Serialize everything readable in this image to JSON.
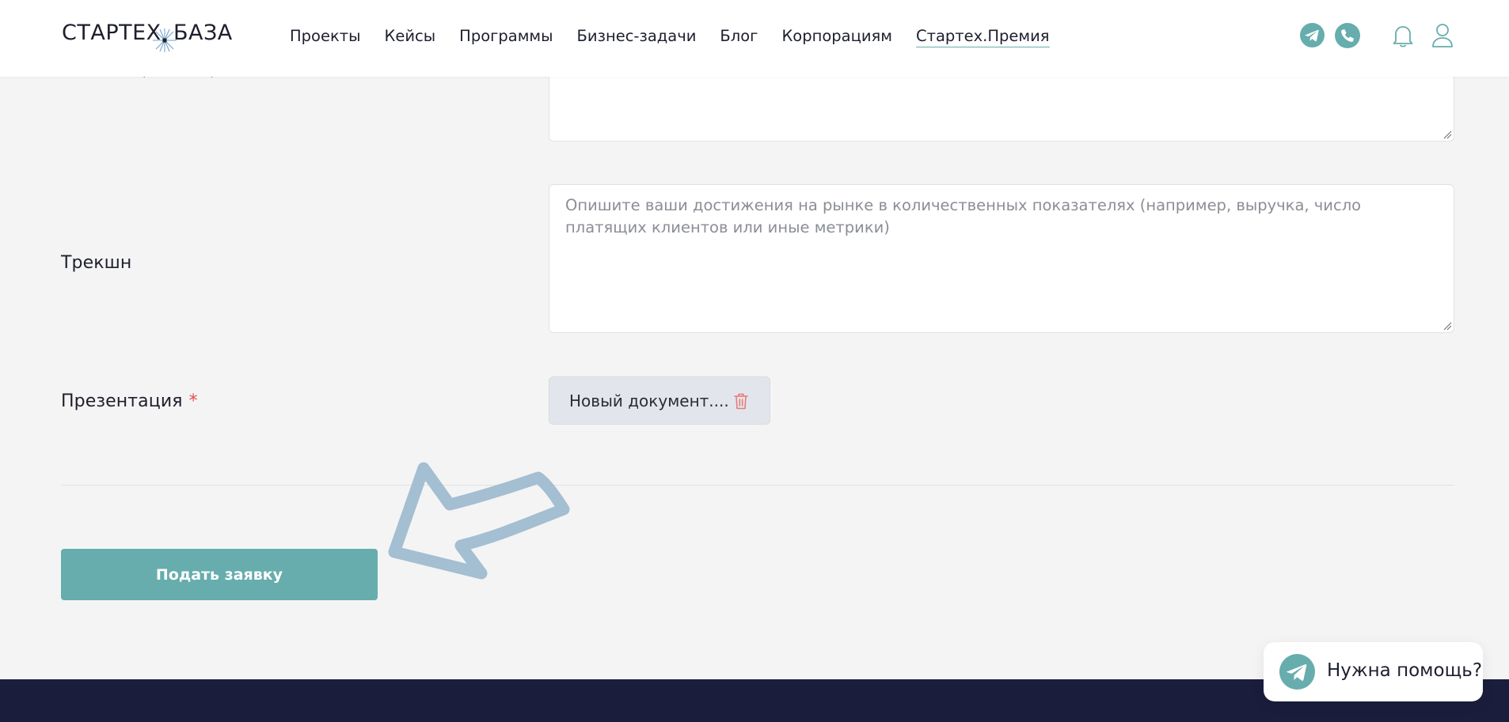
{
  "header": {
    "logo": {
      "left": "СТАРТЕХ",
      "right": "БАЗА"
    },
    "nav": [
      {
        "label": "Проекты"
      },
      {
        "label": "Кейсы"
      },
      {
        "label": "Программы"
      },
      {
        "label": "Бизнес-задачи"
      },
      {
        "label": "Блог"
      },
      {
        "label": "Корпорациям"
      },
      {
        "label": "Стартех.Премия",
        "active": true
      }
    ],
    "icons": [
      "telegram-icon",
      "phone-icon",
      "bell-icon",
      "user-icon"
    ]
  },
  "form": {
    "clipped_label": "Клиенты, кейсы, пилоты",
    "traction": {
      "label": "Трекшн",
      "placeholder": "Опишите ваши достижения на рынке в количественных показателях (например, выручка, число платящих клиентов или иные метрики)"
    },
    "presentation": {
      "label": "Презентация",
      "required_mark": "*",
      "file_name": "Новый документ...."
    },
    "submit_label": "Подать заявку"
  },
  "help": {
    "label": "Нужна помощь?"
  },
  "colors": {
    "accent": "#67adad",
    "required": "#e0504f",
    "footer": "#1a1e3c",
    "arrow": "#9fbbd0"
  }
}
